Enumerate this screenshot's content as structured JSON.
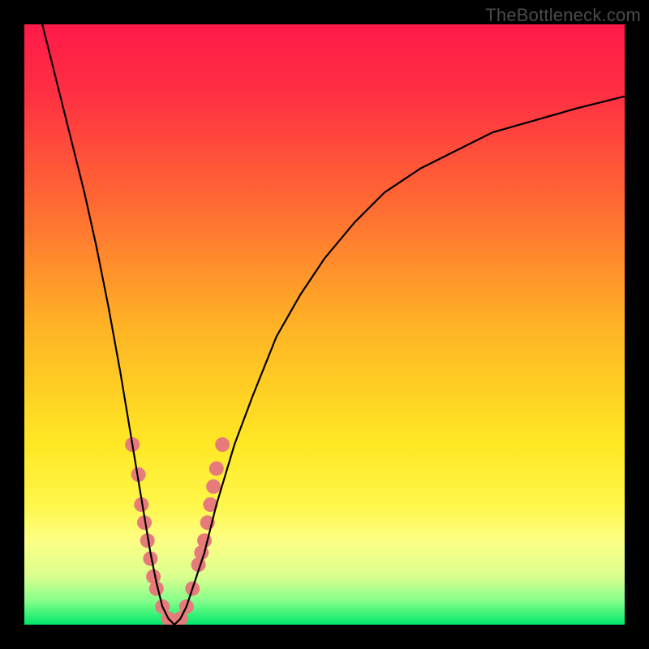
{
  "watermark": {
    "text": "TheBottleneck.com"
  },
  "gradient": {
    "stops": [
      {
        "offset": 0.0,
        "color": "#ff1a49"
      },
      {
        "offset": 0.12,
        "color": "#ff3142"
      },
      {
        "offset": 0.3,
        "color": "#ff6a33"
      },
      {
        "offset": 0.5,
        "color": "#ffb225"
      },
      {
        "offset": 0.7,
        "color": "#ffe824"
      },
      {
        "offset": 0.8,
        "color": "#fff74a"
      },
      {
        "offset": 0.86,
        "color": "#fdff84"
      },
      {
        "offset": 0.92,
        "color": "#d9ff8f"
      },
      {
        "offset": 0.96,
        "color": "#86ff8a"
      },
      {
        "offset": 1.0,
        "color": "#00e86b"
      }
    ]
  },
  "chart_data": {
    "type": "line",
    "title": "",
    "xlabel": "",
    "ylabel": "",
    "xlim": [
      0,
      100
    ],
    "ylim": [
      0,
      100
    ],
    "series": [
      {
        "name": "curve",
        "x": [
          3,
          5,
          8,
          10,
          12,
          14,
          16,
          18,
          19,
          20,
          21,
          22,
          23,
          24,
          25,
          26,
          27,
          28,
          30,
          32,
          35,
          38,
          42,
          46,
          50,
          55,
          60,
          66,
          72,
          78,
          85,
          92,
          100
        ],
        "y": [
          100,
          92,
          80,
          72,
          63,
          53,
          42,
          30,
          24,
          18,
          12,
          7,
          3,
          1,
          0,
          1,
          3,
          6,
          12,
          20,
          30,
          38,
          48,
          55,
          61,
          67,
          72,
          76,
          79,
          82,
          84,
          86,
          88
        ]
      }
    ],
    "dip_markers": {
      "name": "dip-dots",
      "color": "#e77b7b",
      "radius": 9,
      "points": [
        {
          "x": 18,
          "y": 30
        },
        {
          "x": 19,
          "y": 25
        },
        {
          "x": 19.5,
          "y": 20
        },
        {
          "x": 20,
          "y": 17
        },
        {
          "x": 20.5,
          "y": 14
        },
        {
          "x": 21,
          "y": 11
        },
        {
          "x": 21.5,
          "y": 8
        },
        {
          "x": 22,
          "y": 6
        },
        {
          "x": 23,
          "y": 3
        },
        {
          "x": 24,
          "y": 1
        },
        {
          "x": 25,
          "y": 0
        },
        {
          "x": 26,
          "y": 1
        },
        {
          "x": 27,
          "y": 3
        },
        {
          "x": 28,
          "y": 6
        },
        {
          "x": 29,
          "y": 10
        },
        {
          "x": 29.5,
          "y": 12
        },
        {
          "x": 30,
          "y": 14
        },
        {
          "x": 30.5,
          "y": 17
        },
        {
          "x": 31,
          "y": 20
        },
        {
          "x": 31.5,
          "y": 23
        },
        {
          "x": 32,
          "y": 26
        },
        {
          "x": 33,
          "y": 30
        }
      ]
    }
  }
}
